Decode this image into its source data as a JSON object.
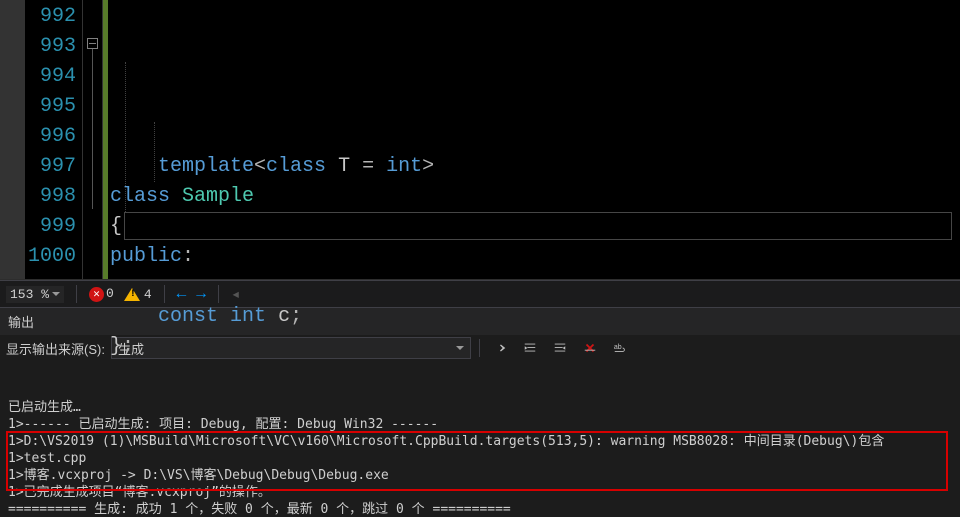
{
  "editor": {
    "line_numbers": [
      "992",
      "993",
      "994",
      "995",
      "996",
      "997",
      "998",
      "999",
      "1000"
    ],
    "code_rows": [
      {
        "indent": "    ",
        "tokens": [
          {
            "cls": "kw",
            "t": "template"
          },
          {
            "cls": "punct",
            "t": "<"
          },
          {
            "cls": "kw",
            "t": "class"
          },
          {
            "cls": "",
            "t": " T "
          },
          {
            "cls": "punct",
            "t": "="
          },
          {
            "cls": "",
            "t": " "
          },
          {
            "cls": "kw",
            "t": "int"
          },
          {
            "cls": "punct",
            "t": ">"
          }
        ]
      },
      {
        "indent": "",
        "tokens": [
          {
            "cls": "kw",
            "t": "class"
          },
          {
            "cls": "",
            "t": " "
          },
          {
            "cls": "type",
            "t": "Sample"
          }
        ]
      },
      {
        "indent": "",
        "tokens": [
          {
            "cls": "brace",
            "t": "{"
          }
        ]
      },
      {
        "indent": "",
        "tokens": [
          {
            "cls": "kw",
            "t": "public"
          },
          {
            "cls": "punct",
            "t": ":"
          }
        ]
      },
      {
        "indent": "",
        "tokens": []
      },
      {
        "indent": "    ",
        "tokens": [
          {
            "cls": "kw",
            "t": "const"
          },
          {
            "cls": "",
            "t": " "
          },
          {
            "cls": "kw",
            "t": "int"
          },
          {
            "cls": "",
            "t": " c"
          },
          {
            "cls": "punct",
            "t": ";"
          }
        ]
      },
      {
        "indent": "",
        "tokens": [
          {
            "cls": "brace",
            "t": "}"
          },
          {
            "cls": "punct",
            "t": ";"
          }
        ]
      },
      {
        "indent": "",
        "tokens": []
      },
      {
        "indent": "",
        "tokens": []
      }
    ]
  },
  "statusbar": {
    "zoom": "153 %",
    "errors": "0",
    "warnings": "4"
  },
  "output": {
    "panel_title": "输出",
    "source_label": "显示输出来源(S):",
    "source_value": "生成",
    "lines": [
      "已启动生成…",
      "1>------ 已启动生成: 项目: Debug, 配置: Debug Win32 ------",
      "1>D:\\VS2019 (1)\\MSBuild\\Microsoft\\VC\\v160\\Microsoft.CppBuild.targets(513,5): warning MSB8028: 中间目录(Debug\\)包含",
      "1>test.cpp",
      "1>博客.vcxproj -> D:\\VS\\博客\\Debug\\Debug\\Debug.exe",
      "1>已完成生成项目“博客.vcxproj”的操作。",
      "========== 生成: 成功 1 个，失败 0 个，最新 0 个，跳过 0 个 =========="
    ]
  },
  "chart_data": null
}
